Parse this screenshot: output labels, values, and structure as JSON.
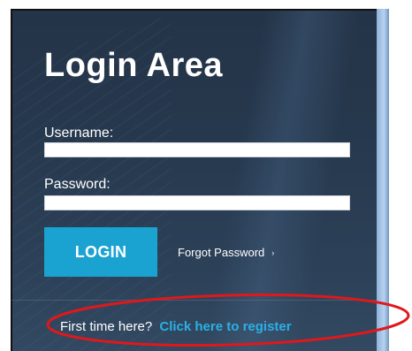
{
  "login_panel": {
    "title": "Login Area",
    "username_label": "Username:",
    "username_value": "",
    "password_label": "Password:",
    "password_value": "",
    "login_button_label": "LOGIN",
    "forgot_password_label": "Forgot Password",
    "forgot_chevron": "›",
    "register_prompt": "First time here?",
    "register_link_label": "Click here to register"
  },
  "colors": {
    "accent": "#1aa2d1",
    "link": "#2ab0e6",
    "annotation": "#e0181b",
    "panel_background": "#26384d"
  },
  "annotation": {
    "shape": "ellipse",
    "color": "#e0181b"
  }
}
